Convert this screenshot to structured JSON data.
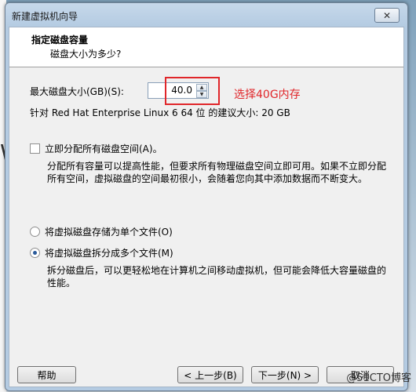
{
  "window": {
    "title": "新建虚拟机向导",
    "close_glyph": "✕"
  },
  "header": {
    "title": "指定磁盘容量",
    "subtitle": "磁盘大小为多少?"
  },
  "disk": {
    "max_size_label": "最大磁盘大小(GB)(S):",
    "size_value": "40.0",
    "recommended_text": "针对 Red Hat Enterprise Linux 6 64 位 的建议大小: 20 GB",
    "annotation": "选择40G内存"
  },
  "allocate": {
    "checkbox_label": "立即分配所有磁盘空间(A)。",
    "description": "分配所有容量可以提高性能，但要求所有物理磁盘空间立即可用。如果不立即分配所有空间，虚拟磁盘的空间最初很小，会随着您向其中添加数据而不断变大。"
  },
  "storage": {
    "single_file_label": "将虚拟磁盘存储为单个文件(O)",
    "multi_file_label": "将虚拟磁盘拆分成多个文件(M)",
    "multi_file_description": "拆分磁盘后，可以更轻松地在计算机之间移动虚拟机，但可能会降低大容量磁盘的性能。"
  },
  "buttons": {
    "help": "帮助",
    "back": "< 上一步(B)",
    "next": "下一步(N) >",
    "cancel": "取消"
  },
  "watermark": "@51CTO博客",
  "background": {
    "letter": "W"
  }
}
